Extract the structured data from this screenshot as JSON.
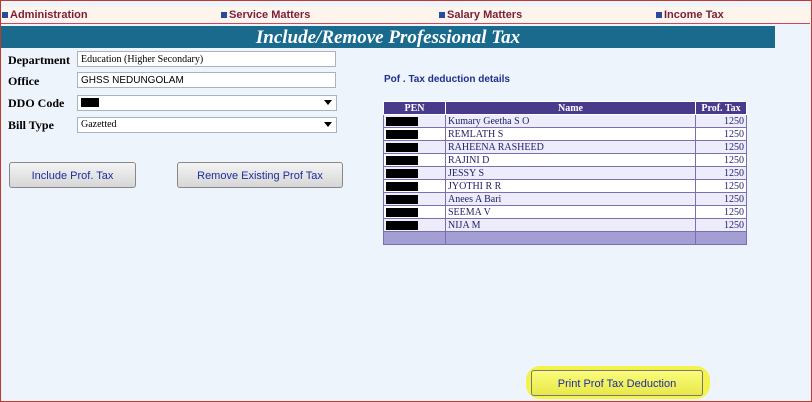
{
  "menu": {
    "items": [
      "Administration",
      "Service Matters",
      "Salary Matters",
      "Income Tax"
    ]
  },
  "page_title": "Include/Remove Professional Tax",
  "form": {
    "department_label": "Department",
    "department_value": "Education (Higher Secondary)",
    "office_label": "Office",
    "office_value": "GHSS NEDUNGOLAM",
    "ddo_label": "DDO Code",
    "bill_type_label": "Bill Type",
    "bill_type_value": "Gazetted"
  },
  "buttons": {
    "include": "Include Prof. Tax",
    "remove": "Remove Existing Prof Tax",
    "print": "Print Prof Tax Deduction"
  },
  "table": {
    "caption": "Pof . Tax deduction details",
    "headers": [
      "PEN",
      "Name",
      "Prof. Tax"
    ],
    "rows": [
      {
        "name": "Kumary Geetha S O",
        "tax": "1250"
      },
      {
        "name": "REMLATH S",
        "tax": "1250"
      },
      {
        "name": "RAHEENA RASHEED",
        "tax": "1250"
      },
      {
        "name": "RAJINI D",
        "tax": "1250"
      },
      {
        "name": "JESSY S",
        "tax": "1250"
      },
      {
        "name": "JYOTHI R R",
        "tax": "1250"
      },
      {
        "name": "Anees A Bari",
        "tax": "1250"
      },
      {
        "name": "SEEMA V",
        "tax": "1250"
      },
      {
        "name": "NIJA M",
        "tax": "1250"
      }
    ]
  },
  "colors": {
    "title_bar": "#1a6a8e",
    "table_header": "#4a3a8c",
    "highlight": "#f3f34b"
  }
}
